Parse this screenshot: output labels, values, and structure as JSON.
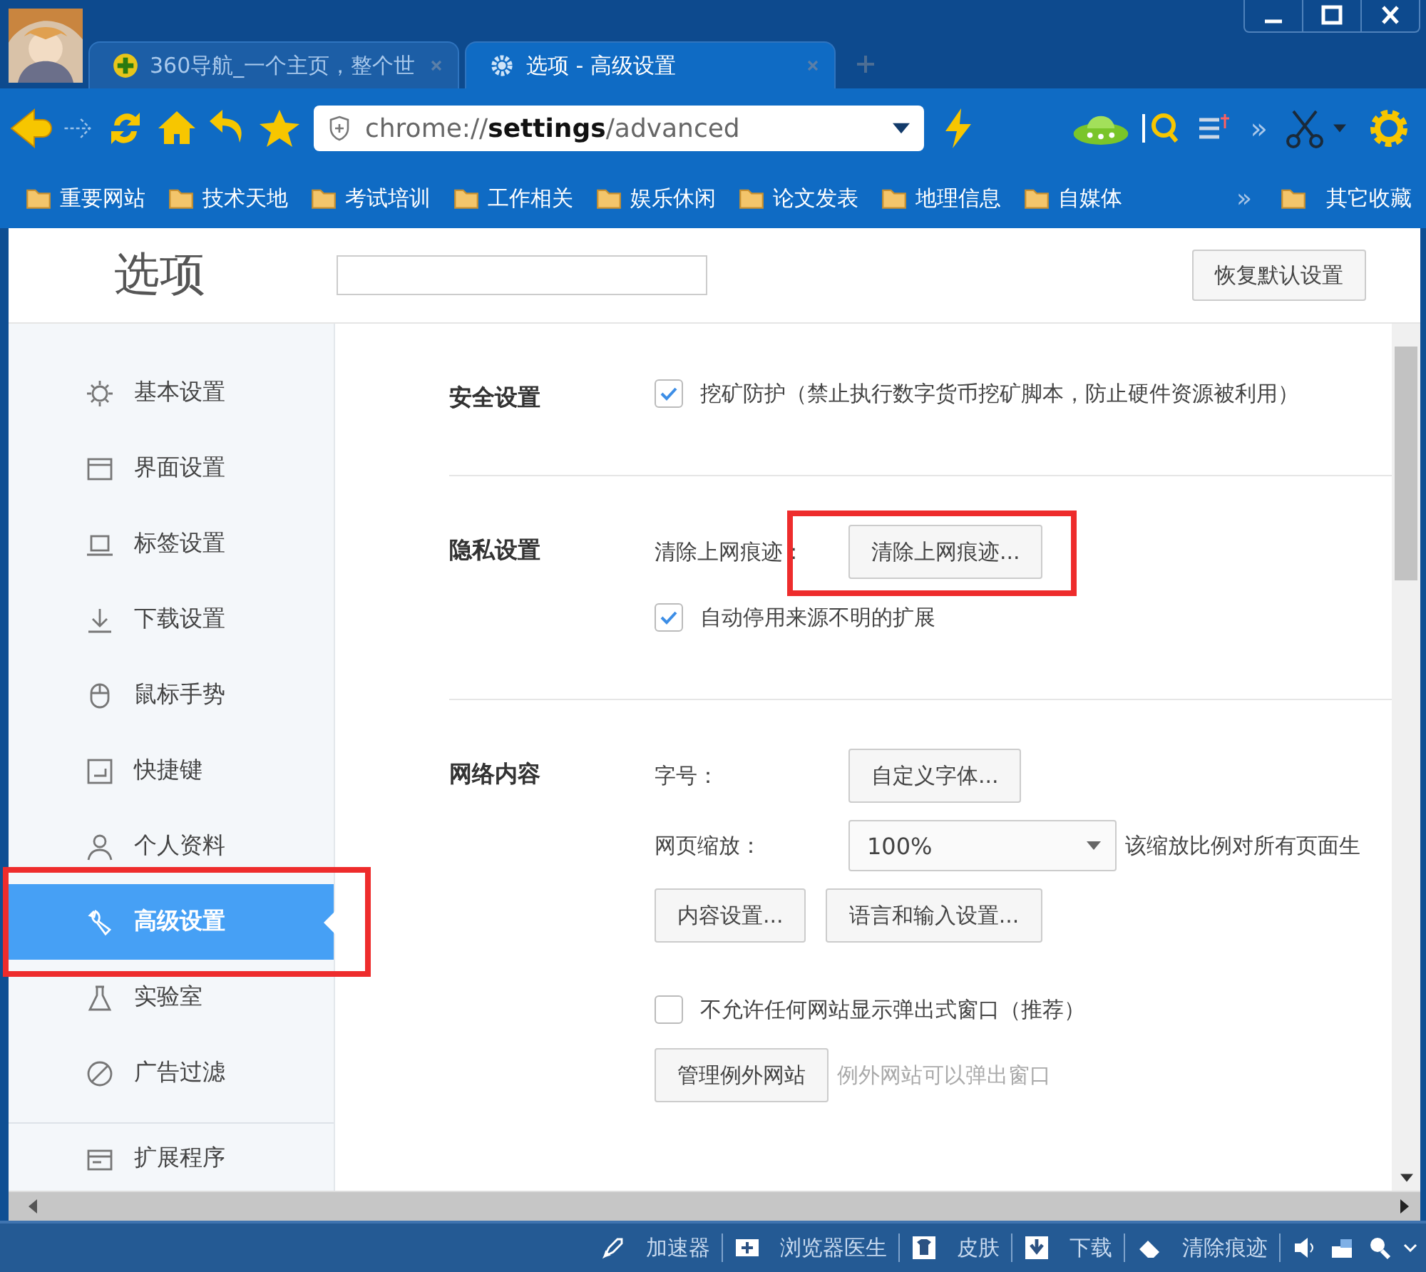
{
  "tabs": [
    {
      "title": "360导航_一个主页，整个世",
      "selected": false
    },
    {
      "title": "选项 - 高级设置",
      "selected": true
    }
  ],
  "toolbar": {
    "address": "chrome://**settings**/advanced",
    "overflow": "»"
  },
  "bookmarks": [
    "重要网站",
    "技术天地",
    "考试培训",
    "工作相关",
    "娱乐休闲",
    "论文发表",
    "地理信息",
    "自媒体"
  ],
  "bookmarks_overflow": "»",
  "other_bookmarks": "其它收藏",
  "settings": {
    "title": "选项",
    "reset_button": "恢复默认设置",
    "sidebar": [
      {
        "label": "基本设置",
        "selected": false,
        "highlighted": false
      },
      {
        "label": "界面设置",
        "selected": false,
        "highlighted": false
      },
      {
        "label": "标签设置",
        "selected": false,
        "highlighted": false
      },
      {
        "label": "下载设置",
        "selected": false,
        "highlighted": false
      },
      {
        "label": "鼠标手势",
        "selected": false,
        "highlighted": false
      },
      {
        "label": "快捷键",
        "selected": false,
        "highlighted": false
      },
      {
        "label": "个人资料",
        "selected": false,
        "highlighted": false
      },
      {
        "label": "高级设置",
        "selected": true,
        "highlighted": true
      },
      {
        "label": "实验室",
        "selected": false,
        "highlighted": false
      },
      {
        "label": "广告过滤",
        "selected": false,
        "highlighted": false
      }
    ],
    "sidebar_footer": {
      "label": "扩展程序",
      "selected": false
    },
    "sections": [
      {
        "title": "安全设置",
        "items": [
          {
            "kind": "checkbox",
            "label": "挖矿防护（禁止执行数字货币挖矿脚本，防止硬件资源被利用）",
            "checked": true
          }
        ]
      },
      {
        "title": "隐私设置",
        "items": [
          {
            "kind": "button",
            "label": "清除上网痕迹：",
            "button": "清除上网痕迹...",
            "highlighted": true
          },
          {
            "kind": "checkbox",
            "label": "自动停用来源不明的扩展",
            "checked": true
          }
        ]
      },
      {
        "title": "网络内容",
        "items": [
          {
            "kind": "button",
            "label": "字号：",
            "button": "自定义字体...",
            "highlighted": false
          },
          {
            "kind": "select",
            "label": "网页缩放：",
            "value": "100%",
            "note": "该缩放比例对所有页面生"
          },
          {
            "kind": "buttons",
            "buttons": [
              "内容设置...",
              "语言和输入设置..."
            ]
          },
          {
            "kind": "checkbox",
            "label": "不允许任何网站显示弹出式窗口（推荐）",
            "checked": false
          },
          {
            "kind": "hint",
            "button": "管理例外网站",
            "hint": "例外网站可以弹出窗口"
          }
        ]
      }
    ]
  },
  "status_bar": [
    "加速器",
    "浏览器医生",
    "皮肤",
    "下载",
    "清除痕迹"
  ]
}
